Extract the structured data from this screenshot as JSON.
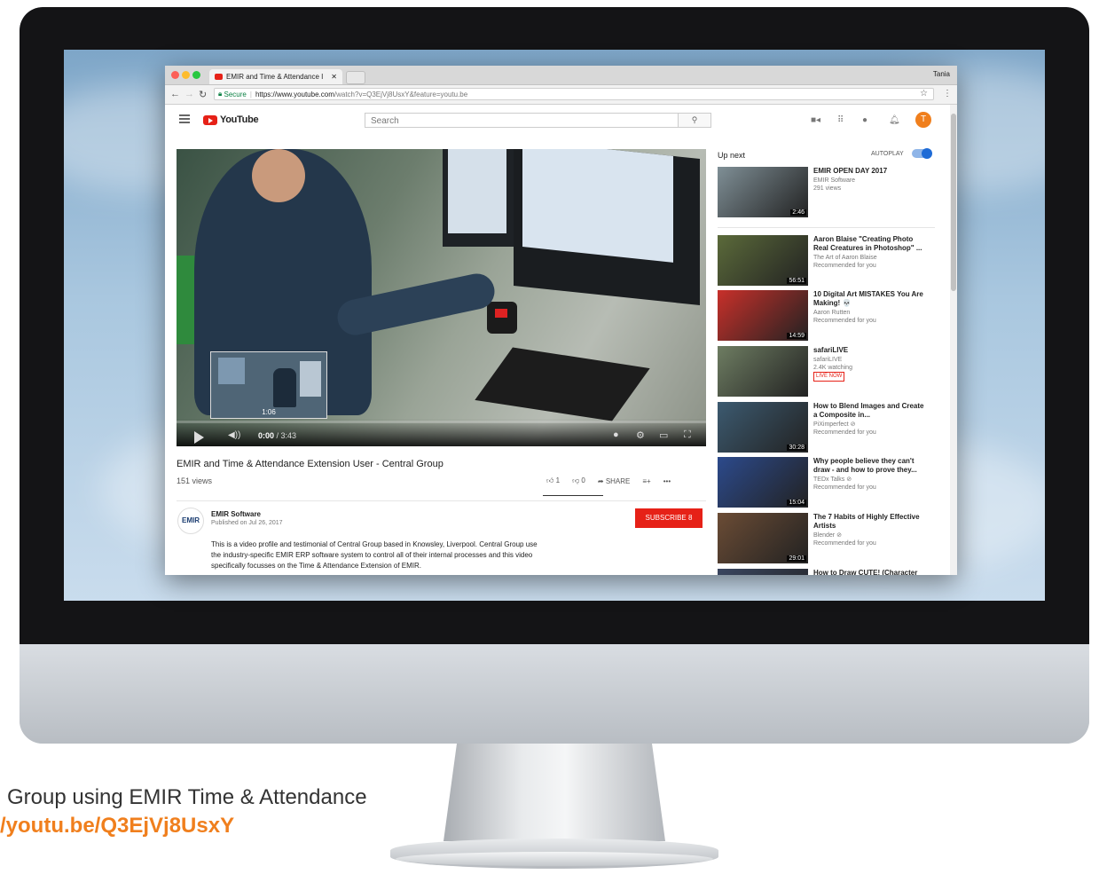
{
  "browser": {
    "tab_title": "EMIR and Time & Attendance I",
    "user": "Tania",
    "secure_label": "Secure",
    "url_host": "https://www.youtube.com",
    "url_rest": "/watch?v=Q3EjVj8UsxY&feature=youtu.be"
  },
  "youtube": {
    "logo_text": "YouTube",
    "search_placeholder": "Search",
    "avatar_letter": "T"
  },
  "player": {
    "preview_time": "1:06",
    "current_time": "0:00",
    "duration": "/ 3:43"
  },
  "video": {
    "title": "EMIR and Time & Attendance Extension User - Central Group",
    "views": "151 views",
    "likes": "1",
    "dislikes": "0",
    "share_label": "SHARE",
    "more_label": "•••"
  },
  "channel": {
    "avatar_text": "EMIR",
    "name": "EMIR Software",
    "published": "Published on Jul 26, 2017",
    "subscribe_label": "SUBSCRIBE",
    "subscriber_count": "8",
    "description": "This is a video profile and testimonial of Central Group based in Knowsley, Liverpool.   Central Group use the industry-specific EMIR ERP software system to control all of their internal processes and this video specifically focusses on the Time & Attendance Extension of EMIR."
  },
  "sidebar": {
    "upnext_label": "Up next",
    "autoplay_label": "AUTOPLAY",
    "videos": [
      {
        "title": "EMIR OPEN DAY 2017",
        "line1": "EMIR Software",
        "line2": "291 views",
        "duration": "2:46",
        "color": "#7f8f96"
      },
      {
        "title": "Aaron Blaise \"Creating Photo Real Creatures in Photoshop\" ...",
        "line1": "The Art of Aaron Blaise",
        "line2": "Recommended for you",
        "duration": "56:51",
        "color": "#5b6a3a"
      },
      {
        "title": "10 Digital Art MISTAKES You Are Making! 💀",
        "line1": "Aaron Rutten",
        "line2": "Recommended for you",
        "duration": "14:59",
        "color": "#c8302a"
      },
      {
        "title": "safariLIVE",
        "line1": "safariLIVE",
        "line2": "2.4K watching",
        "badge": "LIVE NOW",
        "duration": "",
        "color": "#6e7d62"
      },
      {
        "title": "How to Blend Images and Create a Composite in...",
        "line1": "PiXimperfect ⊘",
        "line2": "Recommended for you",
        "duration": "30:28",
        "color": "#3c5a70"
      },
      {
        "title": "Why people believe they can't draw - and how to prove they...",
        "line1": "TEDx Talks ⊘",
        "line2": "Recommended for you",
        "duration": "15:04",
        "color": "#2c4a8c"
      },
      {
        "title": "The 7 Habits of Highly Effective Artists",
        "line1": "Blender ⊘",
        "line2": "Recommended for you",
        "duration": "29:01",
        "color": "#6b4c35"
      },
      {
        "title": "How to Draw CUTE! (Character",
        "line1": "",
        "line2": "",
        "duration": "",
        "color": "#3a4660"
      }
    ]
  },
  "caption": {
    "line1": "Group using EMIR Time & Attendance",
    "link": "/youtu.be/Q3EjVj8UsxY"
  }
}
